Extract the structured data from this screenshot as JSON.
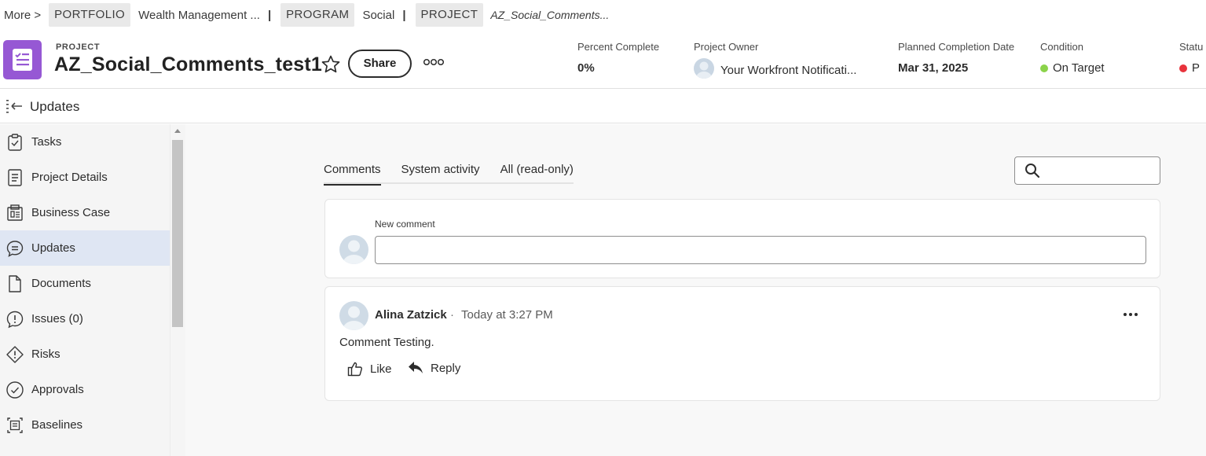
{
  "breadcrumb": {
    "more": "More >",
    "portfolio_tag": "PORTFOLIO",
    "portfolio_name": "Wealth Management ...",
    "program_tag": "PROGRAM",
    "program_name": "Social",
    "project_tag": "PROJECT",
    "project_name": "AZ_Social_Comments...",
    "separator": "|"
  },
  "project": {
    "type_label": "PROJECT",
    "title": "AZ_Social_Comments_test1",
    "share_label": "Share"
  },
  "fields": {
    "percent_complete": {
      "label": "Percent Complete",
      "value": "0%"
    },
    "owner": {
      "label": "Project Owner",
      "value": "Your Workfront Notificati..."
    },
    "planned_completion": {
      "label": "Planned Completion Date",
      "value": "Mar 31, 2025"
    },
    "condition": {
      "label": "Condition",
      "value": "On Target",
      "color": "#8bd34a"
    },
    "status": {
      "label": "Statu",
      "value": "P",
      "color": "#e8333c"
    }
  },
  "section_title": "Updates",
  "sidebar": {
    "items": [
      {
        "label": "Tasks",
        "icon": "clipboard-check-icon"
      },
      {
        "label": "Project Details",
        "icon": "document-lines-icon"
      },
      {
        "label": "Business Case",
        "icon": "business-case-icon"
      },
      {
        "label": "Updates",
        "icon": "speech-bubble-icon",
        "active": true
      },
      {
        "label": "Documents",
        "icon": "file-icon"
      },
      {
        "label": "Issues (0)",
        "icon": "alert-bubble-icon"
      },
      {
        "label": "Risks",
        "icon": "diamond-alert-icon"
      },
      {
        "label": "Approvals",
        "icon": "check-circle-icon"
      },
      {
        "label": "Baselines",
        "icon": "baseline-icon"
      }
    ]
  },
  "tabs": [
    {
      "label": "Comments",
      "active": true
    },
    {
      "label": "System activity"
    },
    {
      "label": "All (read-only)"
    }
  ],
  "search": {
    "placeholder": ""
  },
  "new_comment": {
    "label": "New comment",
    "placeholder": ""
  },
  "comment": {
    "author": "Alina Zatzick",
    "separator": "·",
    "timestamp": "Today at 3:27 PM",
    "text": "Comment Testing.",
    "like_label": "Like",
    "reply_label": "Reply"
  }
}
